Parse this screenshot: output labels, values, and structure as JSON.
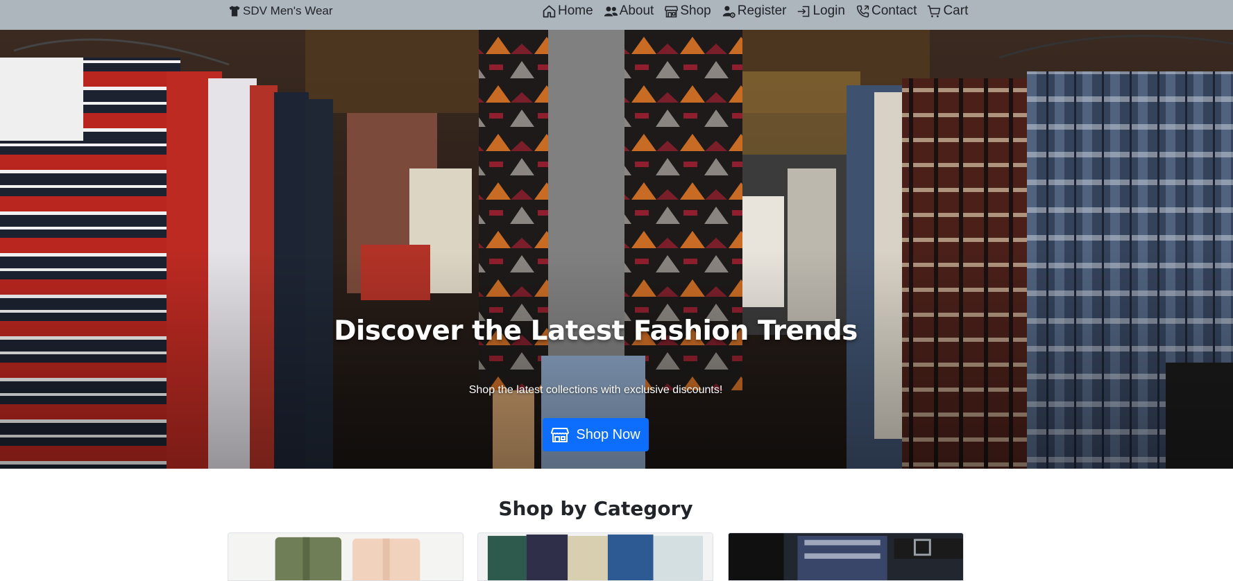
{
  "navbar": {
    "brand": {
      "label": "SDV Men's Wear",
      "icon": "tshirt-icon"
    },
    "items": [
      {
        "label": "Home",
        "icon": "home-icon"
      },
      {
        "label": "About",
        "icon": "people-icon"
      },
      {
        "label": "Shop",
        "icon": "shop-icon"
      },
      {
        "label": "Register",
        "icon": "person-gear-icon"
      },
      {
        "label": "Login",
        "icon": "login-icon"
      },
      {
        "label": "Contact",
        "icon": "phone-icon"
      },
      {
        "label": "Cart",
        "icon": "cart-icon"
      }
    ]
  },
  "hero": {
    "title": "Discover the Latest Fashion Trends",
    "subtitle": "Shop the latest collections with exclusive discounts!",
    "button_label": "Shop Now",
    "button_icon": "shop-icon"
  },
  "categories": {
    "title": "Shop by Category"
  },
  "colors": {
    "navbar_bg": "#adb5bd",
    "primary": "#0d6efd",
    "text": "#212529"
  }
}
